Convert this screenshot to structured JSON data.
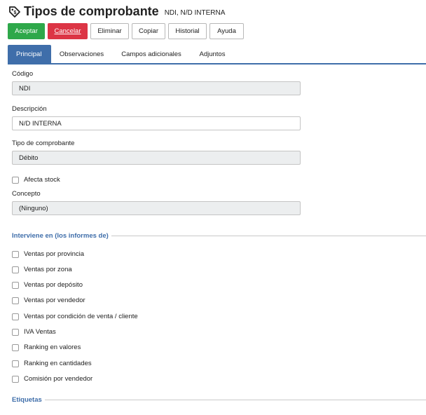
{
  "header": {
    "title": "Tipos de comprobante",
    "subtitle": "NDI, N/D INTERNA",
    "icon": "tag-icon"
  },
  "toolbar": {
    "accept": "Aceptar",
    "cancel": "Cancelar",
    "delete": "Eliminar",
    "copy": "Copiar",
    "history": "Historial",
    "help": "Ayuda",
    "accept_color": "#2ea84a",
    "cancel_color": "#dc3545"
  },
  "tabs": [
    "Principal",
    "Observaciones",
    "Campos adicionales",
    "Adjuntos"
  ],
  "form": {
    "codigo_label": "Código",
    "codigo_value": "NDI",
    "descripcion_label": "Descripción",
    "descripcion_value": "N/D INTERNA",
    "tipo_label": "Tipo de comprobante",
    "tipo_value": "Débito",
    "afecta_stock": "Afecta stock",
    "concepto_label": "Concepto",
    "concepto_value": "(Ninguno)"
  },
  "interviene": {
    "label": "Interviene en (los informes de)",
    "items": [
      "Ventas por provincia",
      "Ventas por zona",
      "Ventas por depósito",
      "Ventas por vendedor",
      "Ventas por condición de venta / cliente",
      "IVA Ventas",
      "Ranking en valores",
      "Ranking en cantidades",
      "Comisión por vendedor"
    ]
  },
  "etiquetas": {
    "label": "Etiquetas"
  },
  "colors": {
    "accent": "#3f6eaa"
  }
}
